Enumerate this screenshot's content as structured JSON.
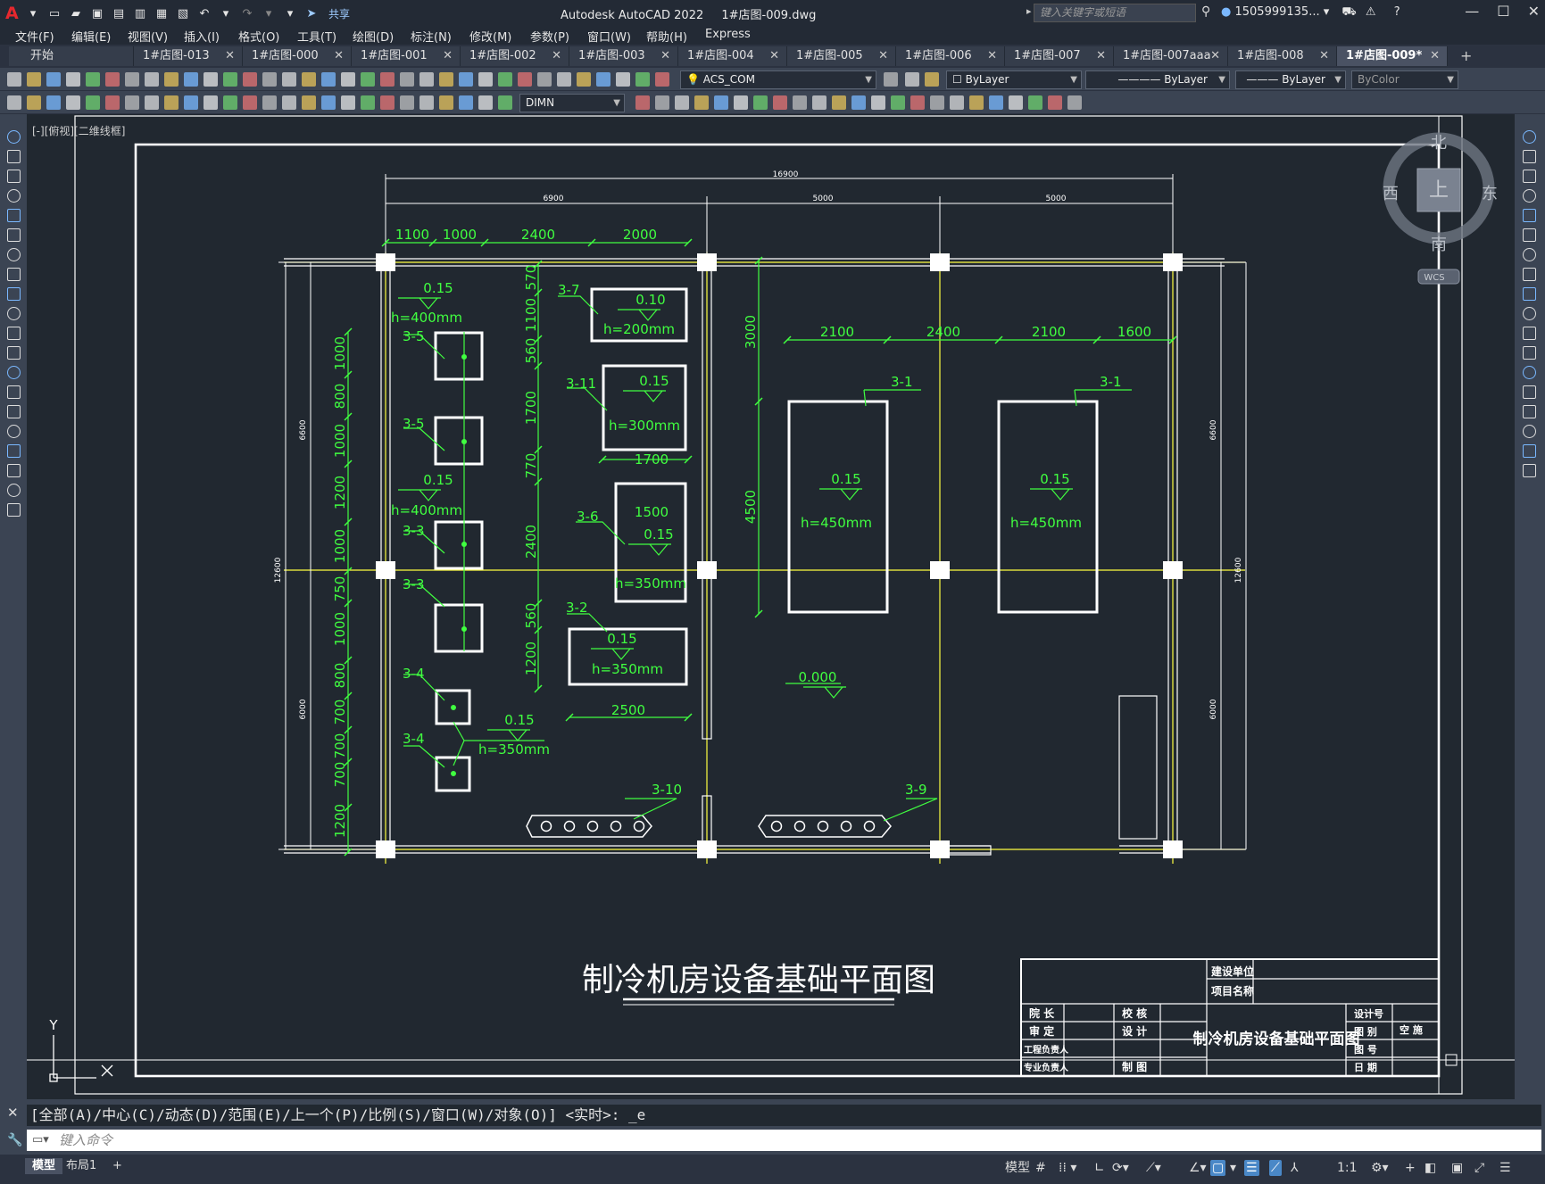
{
  "app": {
    "title": "Autodesk AutoCAD 2022",
    "filename": "1#店图-009.dwg",
    "search_placeholder": "键入关键字或短语",
    "user": "1505999135...",
    "share_label": "共享"
  },
  "menu": [
    "文件(F)",
    "编辑(E)",
    "视图(V)",
    "插入(I)",
    "格式(O)",
    "工具(T)",
    "绘图(D)",
    "标注(N)",
    "修改(M)",
    "参数(P)",
    "窗口(W)",
    "帮助(H)",
    "Express"
  ],
  "tabs": [
    {
      "label": "开始",
      "active": false
    },
    {
      "label": "1#店图-013",
      "active": false
    },
    {
      "label": "1#店图-000",
      "active": false
    },
    {
      "label": "1#店图-001",
      "active": false
    },
    {
      "label": "1#店图-002",
      "active": false
    },
    {
      "label": "1#店图-003",
      "active": false
    },
    {
      "label": "1#店图-004",
      "active": false
    },
    {
      "label": "1#店图-005",
      "active": false
    },
    {
      "label": "1#店图-006",
      "active": false
    },
    {
      "label": "1#店图-007",
      "active": false
    },
    {
      "label": "1#店图-007aaa",
      "active": false
    },
    {
      "label": "1#店图-008",
      "active": false
    },
    {
      "label": "1#店图-009*",
      "active": true
    }
  ],
  "toolbar": {
    "layer_combo": "ACS_COM",
    "color_combo": "ByLayer",
    "linetype_combo": "ByLayer",
    "lineweight_combo": "ByLayer",
    "plotstyle_combo": "ByColor",
    "dimstyle_combo": "DIMN"
  },
  "viewport_label": "[-][俯视][二维线框]",
  "viewcube": {
    "north": "北",
    "south": "南",
    "east": "东",
    "west": "西",
    "face": "上",
    "wcs": "WCS"
  },
  "ucs": {
    "x": "X",
    "y": "Y"
  },
  "drawing": {
    "main_title": "制冷机房设备基础平面图",
    "overall_width": "16900",
    "top_dims": [
      "6900",
      "5000",
      "5000"
    ],
    "sub_dims_left": [
      "1100",
      "1000",
      "2400",
      "2000"
    ],
    "sub_dims_right": [
      "2100",
      "2400",
      "2100",
      "1600"
    ],
    "left_vert_dims": [
      "1000",
      "800",
      "1000",
      "1200",
      "1000",
      "750",
      "1000",
      "800",
      "700",
      "700",
      "700",
      "1200"
    ],
    "col_vert_dims": [
      "570",
      "1100",
      "560",
      "1700",
      "770",
      "2400",
      "560",
      "1200"
    ],
    "right_vert_dims": [
      "3000",
      "4500"
    ],
    "outer_left_dims": [
      "6600",
      "12600",
      "6000"
    ],
    "outer_right_dims": [
      "6600",
      "12600",
      "6000"
    ],
    "labels": {
      "l37": "3-7",
      "l35a": "3-5",
      "l35b": "3-5",
      "l33a": "3-3",
      "l33b": "3-3",
      "l34a": "3-4",
      "l34b": "3-4",
      "l311": "3-11",
      "l36": "3-6",
      "l32": "3-2",
      "l310": "3-10",
      "l39": "3-9",
      "l31a": "3-1",
      "l31b": "3-1"
    },
    "elev": {
      "e1": "0.15",
      "e2": "0.15",
      "e3": "0.10",
      "e4": "0.15",
      "e5": "0.15",
      "e6": "0.15",
      "e7": "0.15",
      "e8": "0.15",
      "e9": "0.15",
      "e10": "0.000"
    },
    "heights": {
      "h1": "h=400mm",
      "h2": "h=400mm",
      "h3": "h=200mm",
      "h4": "h=300mm",
      "h5": "h=350mm",
      "h6": "h=350mm",
      "h7": "h=350mm",
      "h8": "h=450mm",
      "h9": "h=450mm"
    },
    "inner_dims": {
      "d1700": "1700",
      "d1500": "1500",
      "d2500": "2500"
    }
  },
  "titleblock": {
    "build_unit": "建设单位",
    "project_name": "项目名称",
    "dean": "院 长",
    "review": "审 定",
    "proofread": "校 核",
    "design": "设 计",
    "eng_lead": "工程负责人",
    "spec_lead": "专业负责人",
    "draw": "制 图",
    "design_no": "设计号",
    "drawing_cat": "图 别",
    "hvac": "空 施",
    "drawing_no": "图 号",
    "date": "日 期",
    "title": "制冷机房设备基础平面图"
  },
  "command": {
    "history": "[全部(A)/中心(C)/动态(D)/范围(E)/上一个(P)/比例(S)/窗口(W)/对象(O)] <实时>: _e",
    "placeholder": "键入命令"
  },
  "status": {
    "model_tab": "模型",
    "layout_tab": "布局1",
    "model_btn": "模型",
    "scale": "1:1"
  }
}
